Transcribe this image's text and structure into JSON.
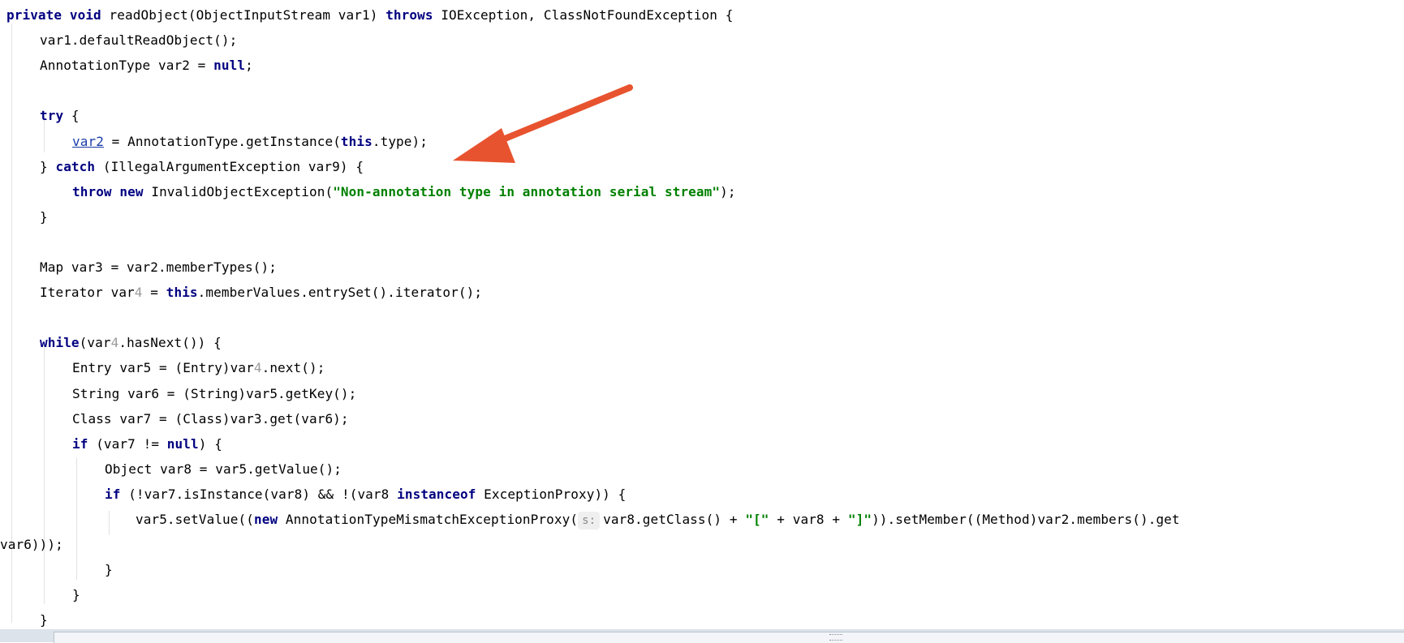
{
  "editor": {
    "lines": [
      {
        "parts": [
          {
            "text": "private void",
            "style": "kw"
          },
          {
            "text": " readObject(ObjectInputStream var1) ",
            "style": ""
          },
          {
            "text": "throws",
            "style": "kw"
          },
          {
            "text": " IOException, ClassNotFoundException {",
            "style": ""
          }
        ]
      },
      {
        "parts": [
          {
            "text": "var1.defaultReadObject();",
            "style": ""
          }
        ]
      },
      {
        "parts": [
          {
            "text": "AnnotationType var2 = ",
            "style": ""
          },
          {
            "text": "null",
            "style": "kw"
          },
          {
            "text": ";",
            "style": ""
          }
        ]
      },
      {
        "parts": []
      },
      {
        "parts": [
          {
            "text": "try",
            "style": "kw"
          },
          {
            "text": " {",
            "style": ""
          }
        ]
      },
      {
        "parts": [
          {
            "text": "var2",
            "style": "link"
          },
          {
            "text": " = AnnotationType.getInstance(",
            "style": ""
          },
          {
            "text": "this",
            "style": "kw"
          },
          {
            "text": ".type);",
            "style": ""
          }
        ]
      },
      {
        "parts": [
          {
            "text": "} ",
            "style": ""
          },
          {
            "text": "catch",
            "style": "kw"
          },
          {
            "text": " (IllegalArgumentException var9) {",
            "style": ""
          }
        ]
      },
      {
        "parts": [
          {
            "text": "throw new",
            "style": "kw"
          },
          {
            "text": " InvalidObjectException(",
            "style": ""
          },
          {
            "text": "\"Non-annotation type in annotation serial stream\"",
            "style": "str"
          },
          {
            "text": ");",
            "style": ""
          }
        ]
      },
      {
        "parts": [
          {
            "text": "}",
            "style": ""
          }
        ]
      },
      {
        "parts": []
      },
      {
        "parts": [
          {
            "text": "Map var3 = var2.memberTypes();",
            "style": ""
          }
        ]
      },
      {
        "parts": [
          {
            "text": "Iterator var",
            "style": ""
          },
          {
            "text": "4",
            "style": "grey"
          },
          {
            "text": " = ",
            "style": ""
          },
          {
            "text": "this",
            "style": "kw"
          },
          {
            "text": ".memberValues.entrySet().iterator();",
            "style": ""
          }
        ]
      },
      {
        "parts": []
      },
      {
        "parts": [
          {
            "text": "while",
            "style": "kw"
          },
          {
            "text": "(var",
            "style": ""
          },
          {
            "text": "4",
            "style": "grey"
          },
          {
            "text": ".hasNext()) {",
            "style": ""
          }
        ]
      },
      {
        "parts": [
          {
            "text": "Entry var5 = (Entry)var",
            "style": ""
          },
          {
            "text": "4",
            "style": "grey"
          },
          {
            "text": ".next();",
            "style": ""
          }
        ]
      },
      {
        "parts": [
          {
            "text": "String var6 = (String)var5.getKey();",
            "style": ""
          }
        ]
      },
      {
        "parts": [
          {
            "text": "Class var7 = (Class)var3.get(var6);",
            "style": ""
          }
        ]
      },
      {
        "parts": [
          {
            "text": "if",
            "style": "kw"
          },
          {
            "text": " (var7 != ",
            "style": ""
          },
          {
            "text": "null",
            "style": "kw"
          },
          {
            "text": ") {",
            "style": ""
          }
        ]
      },
      {
        "parts": [
          {
            "text": "Object var8 = var5.getValue();",
            "style": ""
          }
        ]
      },
      {
        "parts": [
          {
            "text": "if",
            "style": "kw"
          },
          {
            "text": " (!var7.isInstance(var8) && !(var8 ",
            "style": ""
          },
          {
            "text": "instanceof",
            "style": "kw"
          },
          {
            "text": " ExceptionProxy)) {",
            "style": ""
          }
        ]
      },
      {
        "parts": [
          {
            "text": "var5.setValue((",
            "style": ""
          },
          {
            "text": "new",
            "style": "kw"
          },
          {
            "text": " AnnotationTypeMismatchExceptionProxy(",
            "style": ""
          },
          {
            "text": "s:",
            "style": "hint"
          },
          {
            "text": "var8.getClass() + ",
            "style": ""
          },
          {
            "text": "\"[\"",
            "style": "str"
          },
          {
            "text": " + var8 + ",
            "style": ""
          },
          {
            "text": "\"]\"",
            "style": "str"
          },
          {
            "text": ")).setMember((Method)var2.members().get",
            "style": ""
          }
        ]
      },
      {
        "parts": [
          {
            "text": "var6)));",
            "style": ""
          }
        ]
      },
      {
        "parts": [
          {
            "text": "}",
            "style": ""
          }
        ]
      },
      {
        "parts": [
          {
            "text": "}",
            "style": ""
          }
        ]
      },
      {
        "parts": [
          {
            "text": "}",
            "style": ""
          }
        ]
      }
    ]
  },
  "colors": {
    "keyword": "#000080",
    "string": "#008000",
    "arrow": "#e8532f",
    "link": "#1a3da8"
  }
}
